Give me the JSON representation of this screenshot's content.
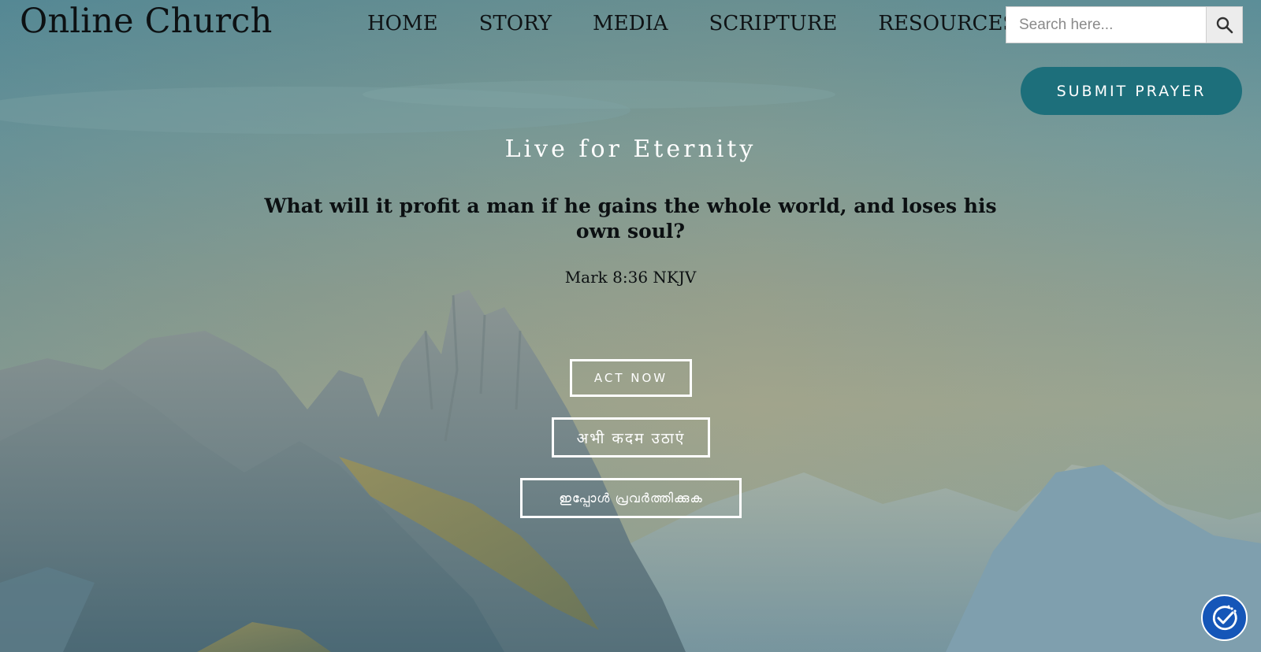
{
  "site": {
    "title": "Online Church"
  },
  "nav": {
    "items": [
      {
        "label": "HOME"
      },
      {
        "label": "STORY"
      },
      {
        "label": "MEDIA"
      },
      {
        "label": "SCRIPTURE"
      },
      {
        "label": "RESOURCES"
      }
    ]
  },
  "search": {
    "placeholder": "Search here...",
    "icon": "search-icon"
  },
  "prayer": {
    "label": "SUBMIT PRAYER"
  },
  "hero": {
    "tagline": "Live for Eternity",
    "verse": "What will it profit a man if he gains the whole world, and loses his own soul?",
    "reference": "Mark 8:36 NKJV"
  },
  "actions": {
    "english": "ACT NOW",
    "hindi": "अभी कदम उठाएं",
    "malayalam": "ഇപ്പോൾ പ്രവർത്തിക്കുക"
  },
  "accessibility": {
    "icon": "accessibility-icon"
  },
  "colors": {
    "accent": "#1d6f7b",
    "accessibility_button": "#1556b8",
    "text_dark": "#0c1012",
    "text_light": "#ffffff"
  }
}
